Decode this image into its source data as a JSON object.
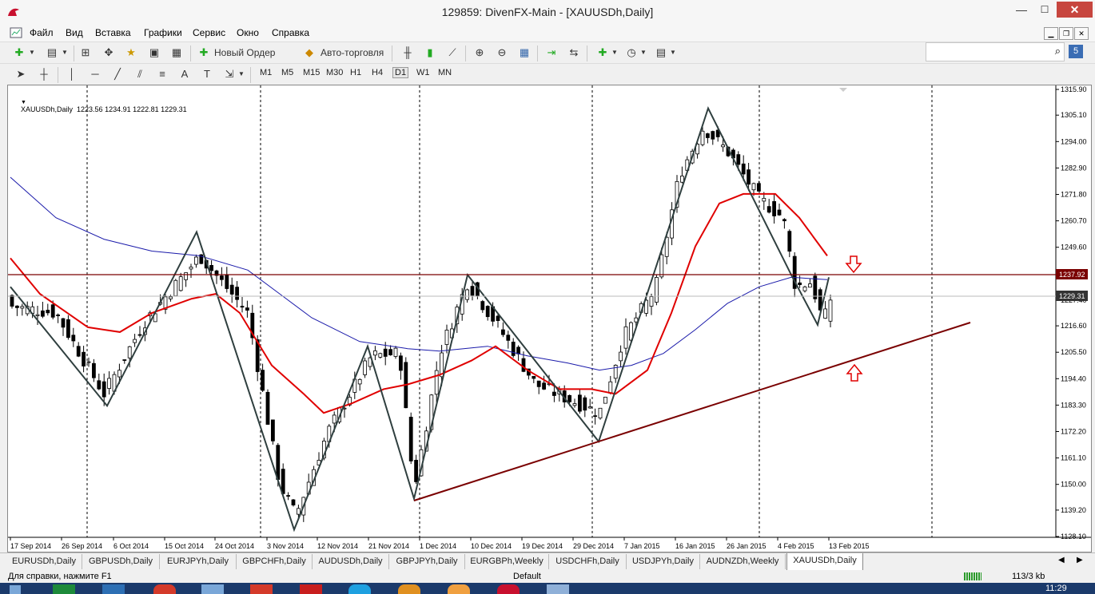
{
  "window": {
    "title": "129859: DivenFX-Main - [XAUUSDh,Daily]",
    "min": "—",
    "max": "☐",
    "close": "✕"
  },
  "menu": [
    "Файл",
    "Вид",
    "Вставка",
    "Графики",
    "Сервис",
    "Окно",
    "Справка"
  ],
  "toolbar": {
    "new_order": "Новый Ордер",
    "autotrading": "Авто-торговля",
    "timeframes": [
      "M1",
      "M5",
      "M15",
      "M30",
      "H1",
      "H4",
      "D1",
      "W1",
      "MN"
    ],
    "search_placeholder": ""
  },
  "chart": {
    "header": "XAUUSDh,Daily  1223.56 1234.91 1222.81 1229.31",
    "price_axis": [
      "1315.90",
      "1305.10",
      "1294.00",
      "1282.90",
      "1271.80",
      "1260.70",
      "1249.60",
      "1227.40",
      "1216.60",
      "1205.50",
      "1194.40",
      "1183.30",
      "1172.20",
      "1161.10",
      "1150.00",
      "1139.20",
      "1128.10"
    ],
    "resistance_label": "1237.92",
    "last_label": "1229.31",
    "date_axis": [
      "17 Sep 2014",
      "26 Sep 2014",
      "6 Oct 2014",
      "15 Oct 2014",
      "24 Oct 2014",
      "3 Nov 2014",
      "12 Nov 2014",
      "21 Nov 2014",
      "1 Dec 2014",
      "10 Dec 2014",
      "19 Dec 2014",
      "29 Dec 2014",
      "7 Jan 2015",
      "16 Jan 2015",
      "26 Jan 2015",
      "4 Feb 2015",
      "13 Feb 2015"
    ],
    "colors": {
      "ma_fast": "#e00000",
      "ma_slow": "#1a1aaa",
      "zigzag": "#2f3f3f",
      "trendline": "#7a0000",
      "arrow": "#e00000"
    }
  },
  "tabs": [
    "EURUSDh,Daily",
    "GBPUSDh,Daily",
    "EURJPYh,Daily",
    "GBPCHFh,Daily",
    "AUDUSDh,Daily",
    "GBPJPYh,Daily",
    "EURGBPh,Weekly",
    "USDCHFh,Daily",
    "USDJPYh,Daily",
    "AUDNZDh,Weekly",
    "XAUUSDh,Daily"
  ],
  "status": {
    "help": "Для справки, нажмите F1",
    "profile": "Default",
    "traffic": "113/3 kb"
  },
  "taskbar": {
    "clock": "11:29"
  }
}
